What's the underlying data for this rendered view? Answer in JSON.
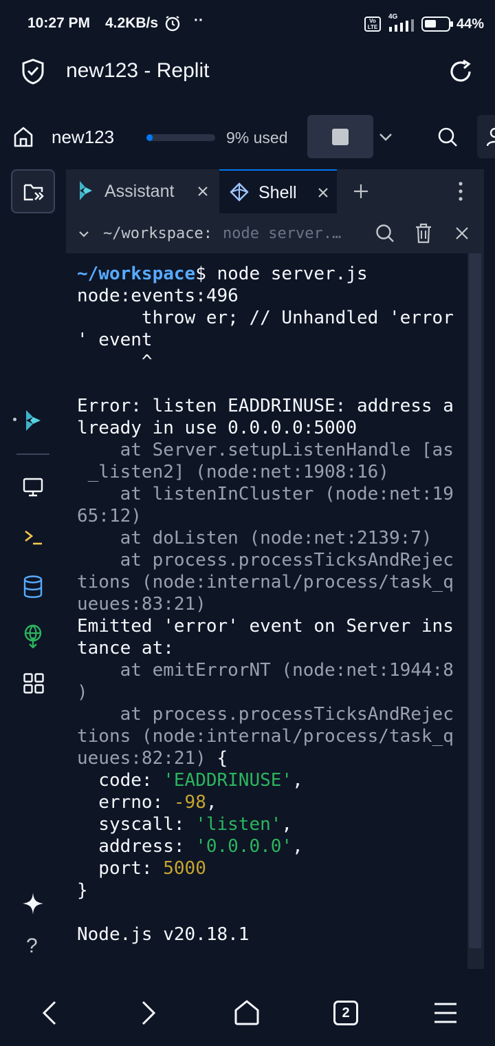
{
  "status_bar": {
    "time": "10:27 PM",
    "net_speed": "4.2KB/s",
    "dots": "··",
    "volte": "Vo LTE",
    "network": "4G",
    "battery": "44%",
    "battery_level": 0.44
  },
  "title_bar": {
    "title": "new123 - Replit",
    "icons": [
      "shield-check-icon",
      "reload-icon"
    ]
  },
  "toolbar": {
    "repl_name": "new123",
    "usage_label": "9% used",
    "usage_fraction": 0.09,
    "icons": [
      "home-icon",
      "stop-icon",
      "chevron-down-icon",
      "search-icon",
      "user-icon"
    ]
  },
  "tabs": [
    {
      "label": "Assistant",
      "icon": "assistant-icon",
      "active": false
    },
    {
      "label": "Shell",
      "icon": "shell-icon",
      "active": true
    }
  ],
  "shell_header": {
    "path": "~/workspace:",
    "command_preview": "node server.…"
  },
  "terminal": {
    "prompt_path": "~/workspace",
    "prompt_symbol": "$",
    "command": " node server.js",
    "l2": "node:events:496",
    "l3": "      throw er; // Unhandled 'error",
    "l4": "' event",
    "l5": "      ^",
    "l7": "Error: listen EADDRINUSE: address a",
    "l8": "lready in use 0.0.0.0:5000",
    "l9": "    at Server.setupListenHandle [as",
    "l10": " _listen2] (node:net:1908:16)",
    "l11": "    at listenInCluster (node:net:19",
    "l12": "65:12)",
    "l13": "    at doListen (node:net:2139:7)",
    "l14": "    at process.processTicksAndRejec",
    "l15": "tions (node:internal/process/task_q",
    "l16": "ueues:83:21)",
    "l17": "Emitted 'error' event on Server ins",
    "l18": "tance at:",
    "l19": "    at emitErrorNT (node:net:1944:8",
    "l20": ")",
    "l21": "    at process.processTicksAndRejec",
    "l22": "tions (node:internal/process/task_q",
    "l23a": "ueues:82:21)",
    "l23b": " {",
    "code_key": "  code: ",
    "code_val": "'EADDRINUSE'",
    "errno_key": "  errno: ",
    "errno_val": "-98",
    "syscall_key": "  syscall: ",
    "syscall_val": "'listen'",
    "address_key": "  address: ",
    "address_val": "'0.0.0.0'",
    "port_key": "  port: ",
    "port_val": "5000",
    "close_brace": "}",
    "node_version": "Node.js v20.18.1",
    "comma": ","
  },
  "nav_bar": {
    "tabs_count": "2",
    "icons": [
      "back-icon",
      "forward-icon",
      "home-icon",
      "tabs-icon",
      "menu-icon"
    ]
  },
  "colors": {
    "background": "#0e1525",
    "panel": "#1c2333",
    "accent": "#0079f2",
    "prompt_path": "#57abff",
    "string": "#2bb55e",
    "number": "#c7a52e"
  }
}
